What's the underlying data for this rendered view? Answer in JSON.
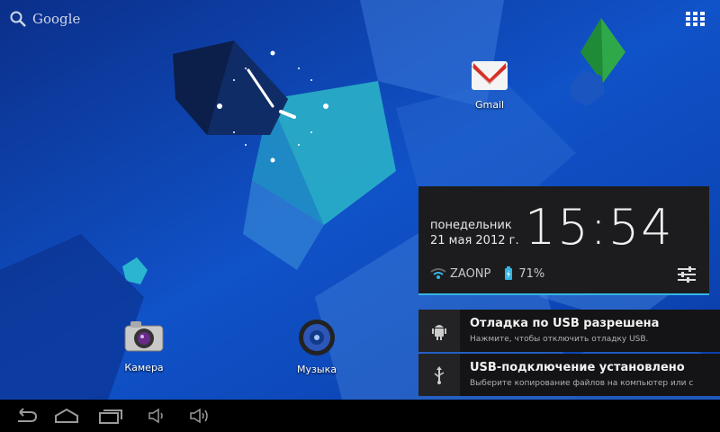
{
  "search": {
    "label": "Google",
    "icon": "search-icon"
  },
  "apps_button": {
    "icon": "all-apps-grid-icon"
  },
  "desktop_apps": [
    {
      "label": "Gmail",
      "icon": "gmail-icon"
    },
    {
      "label": "Камера",
      "icon": "camera-icon"
    },
    {
      "label": "Музыка",
      "icon": "music-icon"
    }
  ],
  "status_panel": {
    "weekday": "понедельник",
    "date": "21 мая 2012 г.",
    "time": "15:54",
    "wifi_name": "ZAONP",
    "battery": "71%",
    "settings_icon": "settings-sliders-icon"
  },
  "notifications": [
    {
      "title": "Отладка по USB разрешена",
      "subtitle": "Нажмите, чтобы отключить отладку USB.",
      "icon": "android-debug-icon"
    },
    {
      "title": "USB-подключение установлено",
      "subtitle": "Выберите копирование файлов на компьютер или с",
      "icon": "usb-icon"
    }
  ],
  "navbar": {
    "buttons": [
      "back-icon",
      "home-icon",
      "recents-icon",
      "volume-down-icon",
      "volume-up-icon"
    ]
  },
  "colors": {
    "accent": "#33b5e5",
    "wallpaper": "#0a3da8",
    "panel": "#1c1c1e",
    "navbar": "#000000"
  }
}
